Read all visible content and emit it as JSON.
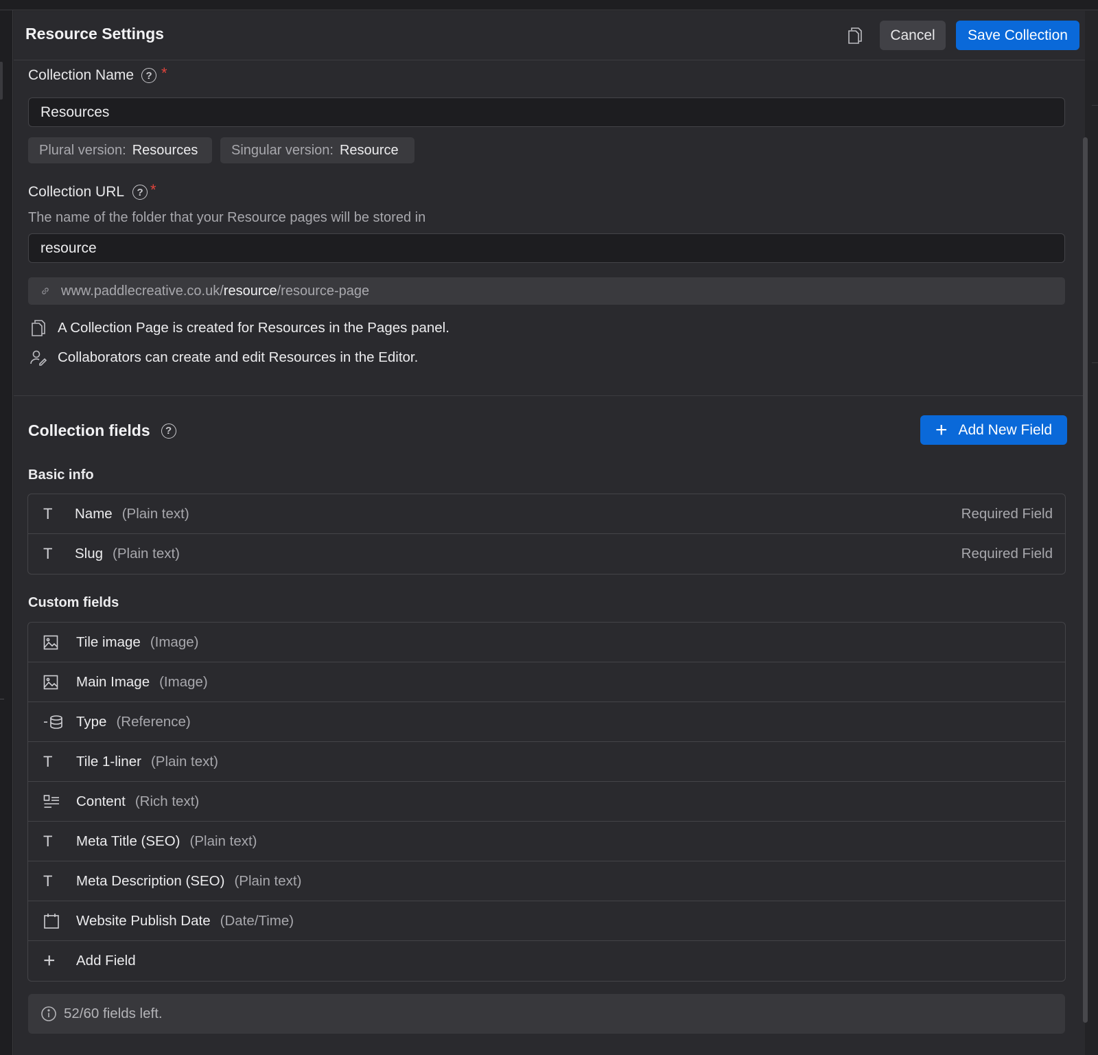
{
  "header": {
    "title": "Resource Settings",
    "cancel_label": "Cancel",
    "save_label": "Save Collection"
  },
  "collection_name": {
    "label": "Collection Name",
    "value": "Resources",
    "plural_key": "Plural version:",
    "plural_value": "Resources",
    "singular_key": "Singular version:",
    "singular_value": "Resource"
  },
  "collection_url": {
    "label": "Collection URL",
    "description": "The name of the folder that your Resource pages will be stored in",
    "value": "resource",
    "preview_domain": "www.paddlecreative.co.uk",
    "preview_folder": "resource",
    "preview_page": "resource-page"
  },
  "info": {
    "pages_note": "A Collection Page is created for Resources in the Pages panel.",
    "editor_note": "Collaborators can create and edit Resources in the Editor."
  },
  "fields": {
    "title": "Collection fields",
    "add_button_label": "Add New Field",
    "basic_title": "Basic info",
    "basic": [
      {
        "name": "Name",
        "type": "(Plain text)",
        "required": "Required Field",
        "icon": "text-icon"
      },
      {
        "name": "Slug",
        "type": "(Plain text)",
        "required": "Required Field",
        "icon": "text-icon"
      }
    ],
    "custom_title": "Custom fields",
    "custom": [
      {
        "name": "Tile image",
        "type": "(Image)",
        "icon": "image-icon"
      },
      {
        "name": "Main Image",
        "type": "(Image)",
        "icon": "image-icon"
      },
      {
        "name": "Type",
        "type": "(Reference)",
        "icon": "reference-icon"
      },
      {
        "name": "Tile 1-liner",
        "type": "(Plain text)",
        "icon": "text-icon"
      },
      {
        "name": "Content",
        "type": "(Rich text)",
        "icon": "rich-text-icon"
      },
      {
        "name": "Meta Title (SEO)",
        "type": "(Plain text)",
        "icon": "text-icon"
      },
      {
        "name": "Meta Description (SEO)",
        "type": "(Plain text)",
        "icon": "text-icon"
      },
      {
        "name": "Website Publish Date",
        "type": "(Date/Time)",
        "icon": "calendar-icon"
      }
    ],
    "add_field_label": "Add Field",
    "fields_left": "52/60 fields left."
  },
  "colors": {
    "accent": "#0a69d9",
    "required": "#e0443c",
    "panel": "#2a2a2e"
  }
}
